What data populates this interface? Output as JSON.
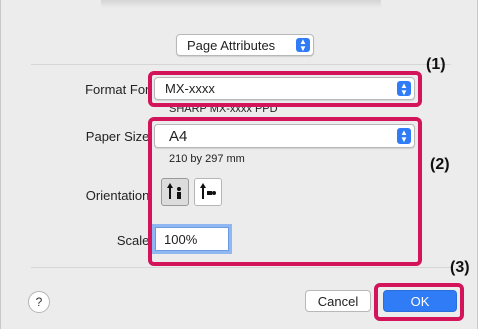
{
  "header": {
    "menu_value": "Page Attributes"
  },
  "format_for": {
    "label": "Format For:",
    "value": "MX-xxxx",
    "subtitle": "SHARP MX-xxxx PPD"
  },
  "paper_size": {
    "label": "Paper Size:",
    "value": "A4",
    "dimensions": "210 by 297 mm"
  },
  "orientation": {
    "label": "Orientation:",
    "options": [
      "portrait",
      "landscape"
    ],
    "selected": "portrait"
  },
  "scale": {
    "label": "Scale:",
    "value": "100%"
  },
  "footer": {
    "help": "?",
    "cancel_label": "Cancel",
    "ok_label": "OK"
  },
  "callouts": {
    "c1": "(1)",
    "c2": "(2)",
    "c3": "(3)"
  },
  "colors": {
    "accent": "#2f7cf6",
    "callout": "#d4145a",
    "dialog_bg": "#ececec"
  }
}
